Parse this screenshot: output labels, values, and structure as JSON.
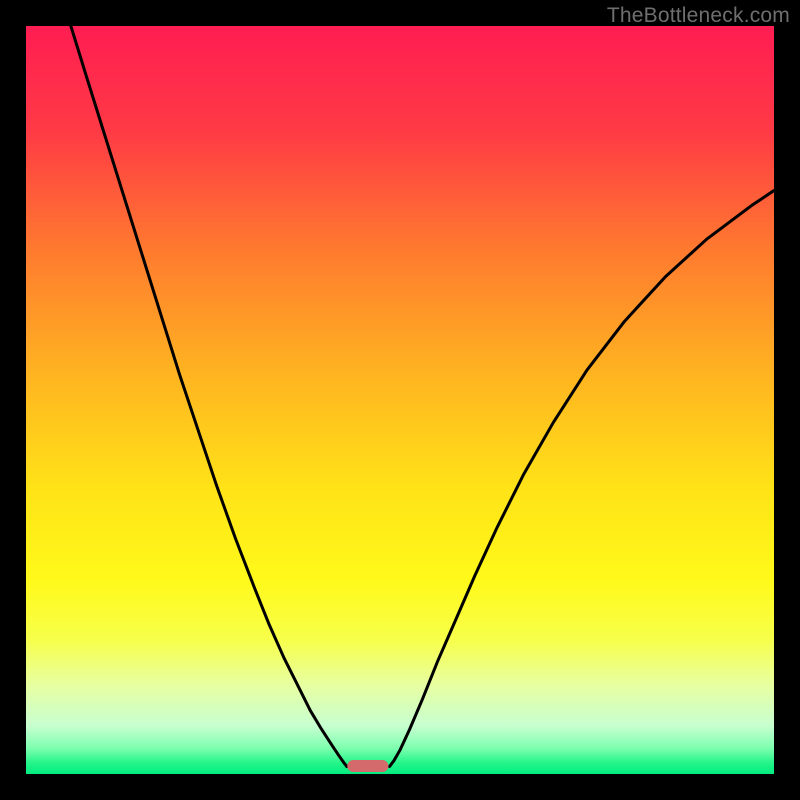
{
  "watermark": {
    "text": "TheBottleneck.com"
  },
  "chart_data": {
    "type": "line",
    "title": "",
    "xlabel": "",
    "ylabel": "",
    "xlim": [
      0,
      100
    ],
    "ylim": [
      0,
      100
    ],
    "grid": false,
    "legend": false,
    "background_gradient_stops": [
      {
        "pos": 0.0,
        "color": "#ff1d52"
      },
      {
        "pos": 0.14,
        "color": "#ff3a45"
      },
      {
        "pos": 0.3,
        "color": "#ff7a2f"
      },
      {
        "pos": 0.46,
        "color": "#ffb221"
      },
      {
        "pos": 0.62,
        "color": "#ffe317"
      },
      {
        "pos": 0.74,
        "color": "#fff91a"
      },
      {
        "pos": 0.82,
        "color": "#f7ff4a"
      },
      {
        "pos": 0.88,
        "color": "#e8ffa0"
      },
      {
        "pos": 0.935,
        "color": "#c8ffd0"
      },
      {
        "pos": 0.965,
        "color": "#7fffb0"
      },
      {
        "pos": 0.985,
        "color": "#25f58a"
      },
      {
        "pos": 1.0,
        "color": "#02ec80"
      }
    ],
    "series": [
      {
        "name": "left-curve",
        "x": [
          6.0,
          8.0,
          10.5,
          13.0,
          15.5,
          18.0,
          20.5,
          23.0,
          25.5,
          28.0,
          30.5,
          32.5,
          34.5,
          36.5,
          38.0,
          39.5,
          40.8,
          41.8,
          42.5,
          42.9
        ],
        "y": [
          100.0,
          93.5,
          85.5,
          77.5,
          69.5,
          61.5,
          53.5,
          46.0,
          38.5,
          31.5,
          25.0,
          20.0,
          15.5,
          11.5,
          8.5,
          6.0,
          4.0,
          2.5,
          1.5,
          1.0
        ]
      },
      {
        "name": "right-curve",
        "x": [
          48.6,
          49.2,
          50.0,
          51.3,
          53.0,
          55.0,
          57.4,
          60.0,
          63.0,
          66.5,
          70.5,
          75.0,
          80.0,
          85.5,
          91.0,
          97.0,
          100.0
        ],
        "y": [
          1.0,
          1.8,
          3.2,
          6.0,
          10.0,
          15.0,
          20.5,
          26.5,
          33.0,
          40.0,
          47.0,
          54.0,
          60.5,
          66.5,
          71.5,
          76.0,
          78.0
        ]
      }
    ],
    "marker": {
      "x": 45.7,
      "width": 5.5,
      "height": 1.6,
      "rx": 0.8,
      "fill": "#d56a6d"
    }
  }
}
